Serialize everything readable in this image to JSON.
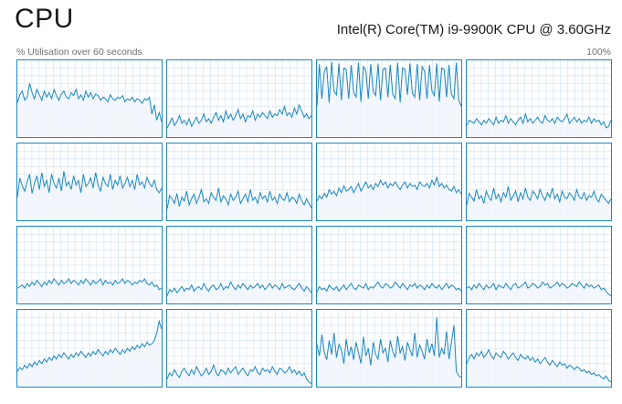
{
  "header": {
    "title": "CPU",
    "cpu_name": "Intel(R) Core(TM) i9-9900K CPU @ 3.60GHz",
    "utilisation_label": "% Utilisation over 60 seconds",
    "max_label": "100%"
  },
  "colors": {
    "line": "#1b87c1",
    "fill": "#f1f6fb",
    "grid": "#d9e8f4",
    "border": "#1b87c1"
  },
  "chart_data": {
    "type": "area",
    "ylim": [
      0,
      100
    ],
    "samples_per_core": 60,
    "cores": [
      {
        "values": [
          45,
          55,
          60,
          48,
          52,
          70,
          58,
          50,
          62,
          55,
          48,
          60,
          52,
          58,
          50,
          62,
          54,
          48,
          56,
          60,
          52,
          50,
          58,
          54,
          62,
          50,
          55,
          48,
          60,
          52,
          58,
          50,
          56,
          54,
          48,
          52,
          50,
          46,
          55,
          50,
          48,
          52,
          50,
          54,
          46,
          50,
          48,
          52,
          46,
          50,
          48,
          44,
          50,
          48,
          52,
          30,
          42,
          22,
          32,
          20
        ]
      },
      {
        "values": [
          12,
          18,
          25,
          15,
          20,
          28,
          18,
          22,
          16,
          24,
          14,
          20,
          26,
          18,
          22,
          30,
          20,
          24,
          18,
          26,
          32,
          22,
          28,
          20,
          34,
          24,
          30,
          22,
          28,
          36,
          24,
          30,
          20,
          28,
          26,
          34,
          22,
          30,
          26,
          32,
          28,
          24,
          34,
          26,
          30,
          28,
          36,
          30,
          40,
          28,
          32,
          26,
          38,
          30,
          42,
          34,
          26,
          30,
          24,
          28
        ]
      },
      {
        "values": [
          40,
          95,
          50,
          85,
          92,
          45,
          98,
          60,
          55,
          96,
          48,
          90,
          88,
          50,
          94,
          58,
          52,
          97,
          46,
          92,
          86,
          50,
          95,
          60,
          54,
          96,
          48,
          88,
          90,
          52,
          94,
          56,
          50,
          97,
          45,
          90,
          88,
          55,
          96,
          58,
          52,
          95,
          48,
          92,
          86,
          50,
          94,
          60,
          54,
          96,
          46,
          90,
          88,
          52,
          94,
          56,
          50,
          97,
          48,
          40
        ]
      },
      {
        "values": [
          15,
          22,
          20,
          18,
          24,
          20,
          16,
          22,
          18,
          24,
          20,
          16,
          26,
          18,
          22,
          20,
          28,
          18,
          24,
          20,
          16,
          22,
          26,
          18,
          30,
          20,
          24,
          18,
          22,
          26,
          20,
          18,
          28,
          22,
          20,
          24,
          18,
          26,
          22,
          20,
          24,
          30,
          18,
          22,
          26,
          20,
          24,
          18,
          22,
          20,
          26,
          18,
          24,
          20,
          22,
          16,
          20,
          12,
          14,
          22
        ]
      },
      {
        "values": [
          30,
          55,
          45,
          38,
          50,
          60,
          35,
          48,
          58,
          40,
          62,
          44,
          52,
          36,
          60,
          48,
          42,
          55,
          38,
          64,
          45,
          50,
          40,
          58,
          46,
          52,
          36,
          60,
          44,
          48,
          55,
          42,
          62,
          46,
          38,
          56,
          48,
          44,
          60,
          40,
          52,
          46,
          58,
          42,
          48,
          56,
          44,
          52,
          40,
          60,
          46,
          50,
          42,
          56,
          48,
          44,
          52,
          40,
          36,
          42
        ]
      },
      {
        "values": [
          15,
          32,
          28,
          22,
          35,
          18,
          30,
          25,
          38,
          20,
          28,
          34,
          22,
          30,
          40,
          24,
          28,
          22,
          36,
          30,
          26,
          42,
          24,
          32,
          28,
          20,
          34,
          26,
          30,
          38,
          22,
          28,
          34,
          24,
          40,
          26,
          30,
          22,
          36,
          28,
          32,
          24,
          38,
          26,
          30,
          22,
          34,
          28,
          26,
          36,
          24,
          30,
          28,
          22,
          34,
          26,
          20,
          28,
          22,
          16
        ]
      },
      {
        "values": [
          25,
          32,
          28,
          35,
          30,
          40,
          34,
          38,
          32,
          42,
          36,
          45,
          38,
          40,
          44,
          36,
          42,
          48,
          38,
          44,
          50,
          42,
          46,
          40,
          48,
          44,
          52,
          46,
          50,
          42,
          48,
          45,
          50,
          44,
          40,
          46,
          50,
          42,
          48,
          44,
          46,
          40,
          50,
          46,
          44,
          48,
          42,
          52,
          46,
          56,
          44,
          48,
          42,
          46,
          40,
          38,
          44,
          36,
          40,
          34
        ]
      },
      {
        "values": [
          20,
          35,
          30,
          25,
          40,
          28,
          32,
          22,
          38,
          30,
          26,
          42,
          28,
          34,
          24,
          36,
          30,
          44,
          26,
          32,
          38,
          24,
          36,
          28,
          42,
          30,
          26,
          38,
          34,
          28,
          40,
          32,
          26,
          36,
          30,
          42,
          28,
          34,
          24,
          38,
          30,
          28,
          36,
          32,
          26,
          40,
          30,
          28,
          36,
          26,
          32,
          30,
          38,
          28,
          24,
          34,
          30,
          26,
          22,
          28
        ]
      },
      {
        "values": [
          20,
          22,
          24,
          20,
          26,
          22,
          28,
          24,
          30,
          26,
          22,
          28,
          24,
          30,
          26,
          32,
          28,
          24,
          30,
          26,
          28,
          32,
          26,
          30,
          28,
          24,
          30,
          26,
          32,
          28,
          24,
          30,
          26,
          28,
          32,
          24,
          30,
          26,
          28,
          24,
          30,
          26,
          28,
          32,
          26,
          30,
          28,
          24,
          28,
          26,
          30,
          28,
          32,
          26,
          24,
          28,
          22,
          24,
          18,
          20
        ]
      },
      {
        "values": [
          10,
          18,
          15,
          20,
          14,
          18,
          22,
          16,
          20,
          18,
          24,
          16,
          20,
          22,
          18,
          26,
          20,
          16,
          22,
          24,
          18,
          20,
          26,
          18,
          22,
          20,
          28,
          22,
          18,
          24,
          20,
          26,
          22,
          18,
          24,
          20,
          22,
          26,
          20,
          24,
          18,
          22,
          26,
          20,
          24,
          22,
          18,
          26,
          20,
          22,
          24,
          20,
          18,
          22,
          26,
          20,
          16,
          22,
          18,
          14
        ]
      },
      {
        "values": [
          15,
          22,
          18,
          20,
          16,
          24,
          20,
          18,
          22,
          16,
          20,
          24,
          18,
          22,
          26,
          20,
          18,
          24,
          22,
          20,
          26,
          18,
          22,
          20,
          24,
          28,
          22,
          20,
          26,
          24,
          20,
          22,
          28,
          24,
          20,
          26,
          22,
          18,
          24,
          22,
          26,
          20,
          24,
          22,
          18,
          24,
          20,
          26,
          22,
          20,
          24,
          18,
          22,
          26,
          20,
          24,
          22,
          18,
          20,
          16
        ]
      },
      {
        "values": [
          20,
          22,
          18,
          24,
          20,
          26,
          22,
          18,
          24,
          20,
          22,
          26,
          18,
          24,
          22,
          20,
          26,
          22,
          18,
          24,
          26,
          20,
          22,
          24,
          28,
          20,
          22,
          26,
          24,
          20,
          22,
          28,
          24,
          26,
          20,
          22,
          24,
          28,
          22,
          26,
          24,
          20,
          22,
          26,
          24,
          22,
          28,
          24,
          20,
          26,
          22,
          24,
          20,
          22,
          24,
          18,
          20,
          16,
          12,
          10
        ]
      },
      {
        "values": [
          20,
          25,
          22,
          28,
          24,
          30,
          26,
          32,
          28,
          34,
          30,
          36,
          32,
          38,
          34,
          40,
          36,
          42,
          38,
          44,
          40,
          36,
          42,
          38,
          44,
          40,
          46,
          42,
          38,
          44,
          40,
          46,
          42,
          48,
          44,
          40,
          46,
          42,
          48,
          44,
          50,
          46,
          42,
          48,
          44,
          50,
          46,
          52,
          48,
          54,
          50,
          56,
          52,
          58,
          54,
          56,
          60,
          70,
          85,
          75
        ]
      },
      {
        "values": [
          10,
          18,
          14,
          22,
          16,
          12,
          20,
          24,
          18,
          14,
          22,
          16,
          26,
          20,
          14,
          18,
          24,
          16,
          20,
          28,
          18,
          14,
          22,
          20,
          16,
          24,
          18,
          22,
          26,
          16,
          20,
          24,
          18,
          14,
          22,
          20,
          26,
          18,
          16,
          24,
          20,
          22,
          18,
          26,
          20,
          16,
          24,
          22,
          18,
          20,
          26,
          18,
          22,
          16,
          20,
          14,
          18,
          10,
          6,
          4
        ]
      },
      {
        "values": [
          55,
          40,
          68,
          45,
          35,
          60,
          42,
          70,
          38,
          55,
          48,
          30,
          62,
          40,
          52,
          35,
          58,
          44,
          30,
          65,
          40,
          50,
          28,
          58,
          42,
          36,
          62,
          44,
          50,
          32,
          60,
          46,
          38,
          66,
          44,
          52,
          34,
          58,
          48,
          40,
          70,
          38,
          54,
          46,
          36,
          62,
          44,
          56,
          40,
          90,
          38,
          50,
          42,
          72,
          36,
          58,
          80,
          20,
          14,
          12
        ]
      },
      {
        "values": [
          30,
          38,
          42,
          36,
          44,
          40,
          46,
          38,
          42,
          48,
          40,
          36,
          44,
          40,
          38,
          46,
          42,
          36,
          40,
          44,
          38,
          34,
          42,
          38,
          36,
          40,
          34,
          38,
          32,
          36,
          30,
          34,
          38,
          32,
          28,
          34,
          30,
          26,
          32,
          28,
          30,
          24,
          28,
          26,
          22,
          26,
          24,
          20,
          22,
          18,
          20,
          16,
          18,
          14,
          16,
          12,
          10,
          14,
          8,
          6
        ]
      }
    ]
  }
}
